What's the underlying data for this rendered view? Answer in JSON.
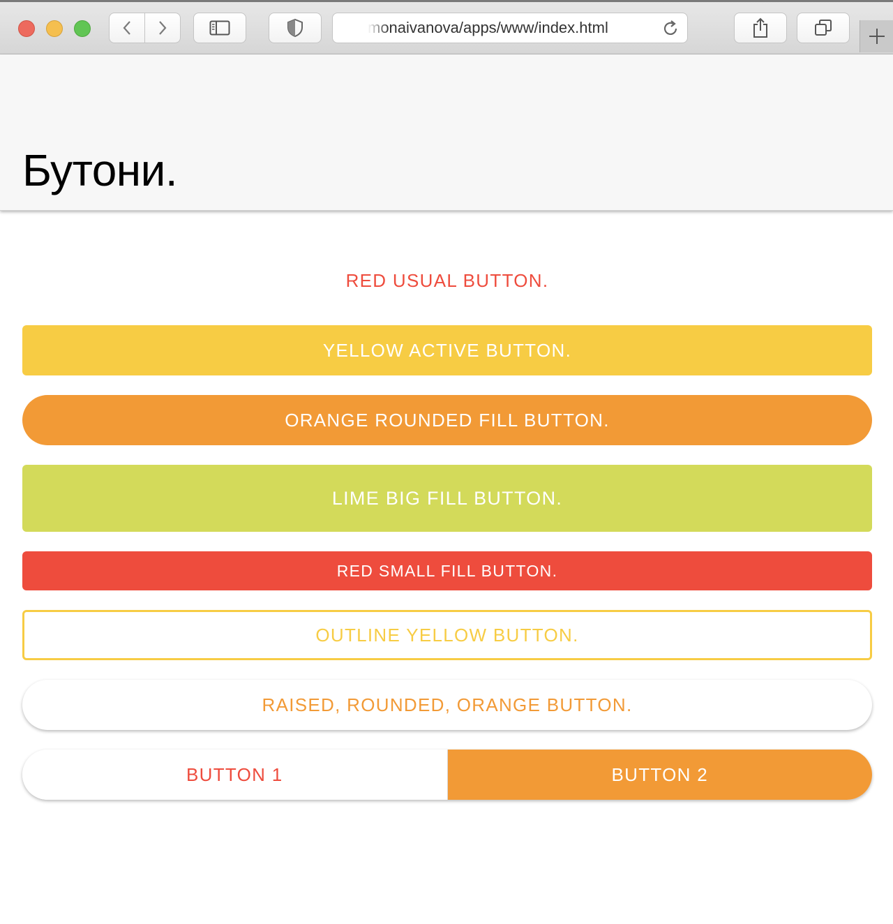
{
  "browser": {
    "address": "monaivanova/apps/www/index.html"
  },
  "page": {
    "title": "Бутони."
  },
  "buttons": {
    "red_usual": "RED USUAL BUTTON.",
    "yellow_active": "YELLOW ACTIVE BUTTON.",
    "orange_rounded_fill": "ORANGE ROUNDED FILL BUTTON.",
    "lime_big_fill": "LIME BIG FILL BUTTON.",
    "red_small_fill": "RED SMALL FILL BUTTON.",
    "outline_yellow": "OUTLINE YELLOW BUTTON.",
    "raised_rounded_orange": "RAISED, ROUNDED, ORANGE BUTTON."
  },
  "segmented": {
    "items": [
      "BUTTON 1",
      "BUTTON 2"
    ],
    "active_index": 1
  },
  "colors": {
    "red": "#ee4c3d",
    "yellow": "#f7cc44",
    "orange": "#f29a36",
    "lime": "#d3da5a"
  }
}
